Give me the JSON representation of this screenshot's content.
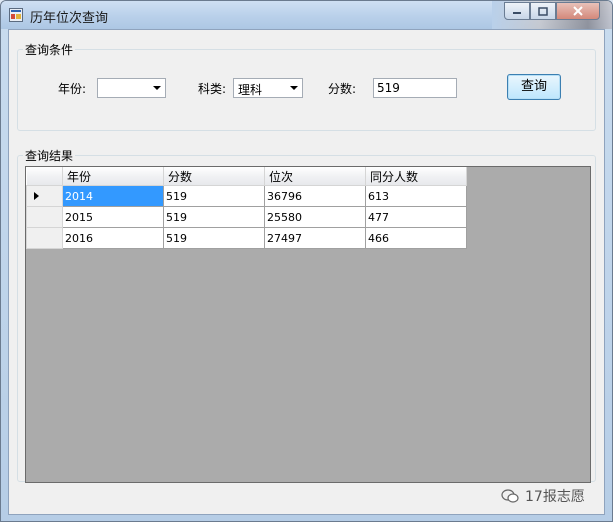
{
  "window": {
    "title": "历年位次查询"
  },
  "criteria": {
    "group_title": "查询条件",
    "year_label": "年份:",
    "year_value": "",
    "subject_label": "科类:",
    "subject_value": "理科",
    "score_label": "分数:",
    "score_value": "519",
    "query_button": "查询"
  },
  "results": {
    "group_title": "查询结果",
    "columns": [
      "年份",
      "分数",
      "位次",
      "同分人数"
    ],
    "rows": [
      [
        "2014",
        "519",
        "36796",
        "613"
      ],
      [
        "2015",
        "519",
        "25580",
        "477"
      ],
      [
        "2016",
        "519",
        "27497",
        "466"
      ]
    ]
  },
  "watermark": {
    "text": "17报志愿"
  },
  "colors": {
    "selection": "#3399ff",
    "grid_background": "#ababab"
  }
}
